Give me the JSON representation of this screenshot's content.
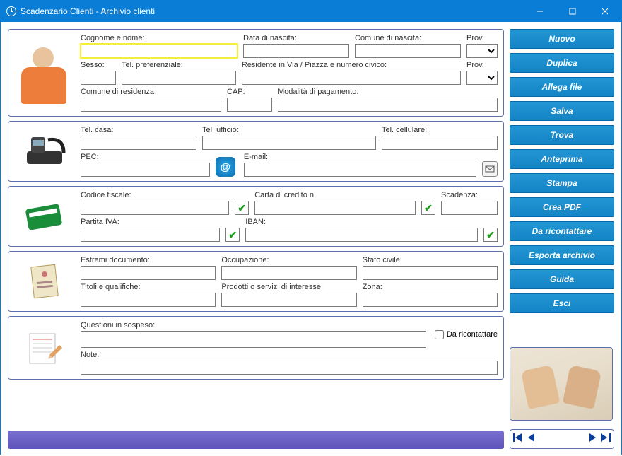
{
  "window": {
    "title": "Scadenzario Clienti - Archivio clienti"
  },
  "panel1": {
    "cognome_nome_lbl": "Cognome e nome:",
    "data_nascita_lbl": "Data di nascita:",
    "comune_nascita_lbl": "Comune di nascita:",
    "prov1_lbl": "Prov.",
    "sesso_lbl": "Sesso:",
    "tel_pref_lbl": "Tel. preferenziale:",
    "residente_lbl": "Residente in Via / Piazza e numero civico:",
    "prov2_lbl": "Prov.",
    "comune_res_lbl": "Comune di residenza:",
    "cap_lbl": "CAP:",
    "mod_pagamento_lbl": "Modalità di pagamento:"
  },
  "panel2": {
    "tel_casa_lbl": "Tel. casa:",
    "tel_ufficio_lbl": "Tel. ufficio:",
    "tel_cell_lbl": "Tel. cellulare:",
    "pec_lbl": "PEC:",
    "email_lbl": "E-mail:"
  },
  "panel3": {
    "cf_lbl": "Codice fiscale:",
    "cc_lbl": "Carta di credito n.",
    "scad_lbl": "Scadenza:",
    "piva_lbl": "Partita IVA:",
    "iban_lbl": "IBAN:"
  },
  "panel4": {
    "estremi_lbl": "Estremi documento:",
    "occup_lbl": "Occupazione:",
    "stato_lbl": "Stato civile:",
    "titoli_lbl": "Titoli e qualifiche:",
    "prodotti_lbl": "Prodotti o servizi di interesse:",
    "zona_lbl": "Zona:"
  },
  "panel5": {
    "questioni_lbl": "Questioni in sospeso:",
    "ricontattare_lbl": "Da ricontattare",
    "note_lbl": "Note:"
  },
  "buttons": {
    "nuovo": "Nuovo",
    "duplica": "Duplica",
    "allega": "Allega file",
    "salva": "Salva",
    "trova": "Trova",
    "anteprima": "Anteprima",
    "stampa": "Stampa",
    "creapdf": "Crea PDF",
    "ricontattare": "Da ricontattare",
    "esporta": "Esporta archivio",
    "guida": "Guida",
    "esci": "Esci"
  }
}
